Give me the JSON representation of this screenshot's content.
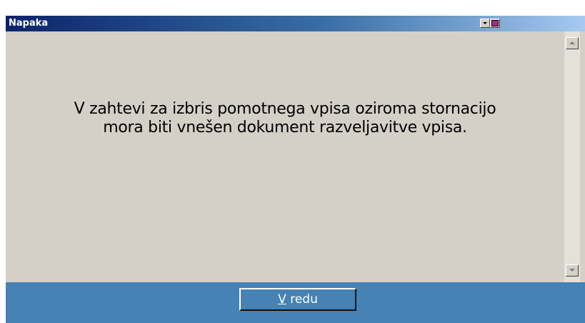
{
  "window": {
    "title": "Napaka"
  },
  "titlebar_buttons": {
    "dropdown_icon": "dropdown-arrow-icon",
    "restore_icon": "restore-icon"
  },
  "message": {
    "line1": "V zahtevi za izbris pomotnega vpisa oziroma stornacijo",
    "line2": "mora biti vnešen dokument razveljavitve vpisa."
  },
  "footer": {
    "ok_accesskey": "V",
    "ok_rest": " redu"
  },
  "colors": {
    "titlebar_start": "#0a246a",
    "titlebar_end": "#a6caf0",
    "dialog_background": "#d4d0c8",
    "footer_background": "#4682b4",
    "button_text": "#ffffff"
  }
}
